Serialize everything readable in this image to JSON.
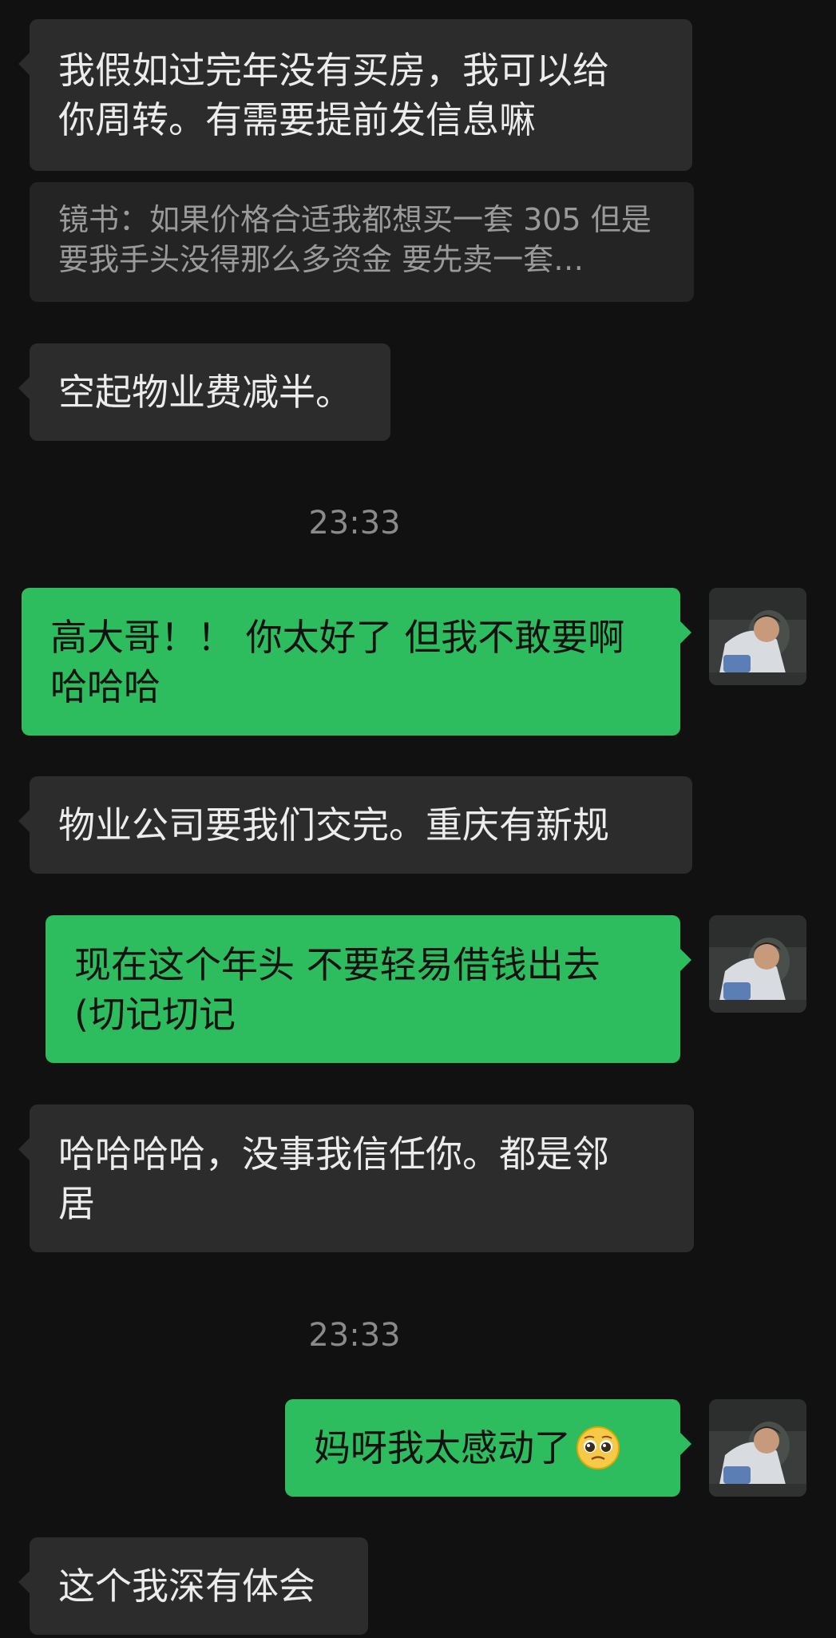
{
  "messages": [
    {
      "side": "left",
      "text": "我假如过完年没有买房，我可以给\n你周转。有需要提前发信息嘛"
    },
    {
      "side": "quote",
      "text": "镜书：如果价格合适我都想买一套 305 但是要我手头没得那么多资金 要先卖一套…"
    },
    {
      "side": "left",
      "text": "空起物业费减半。"
    },
    {
      "side": "timestamp",
      "text": "23:33"
    },
    {
      "side": "right",
      "text": "高大哥！！ 你太好了 但我不敢要啊\n哈哈哈"
    },
    {
      "side": "left",
      "text": "物业公司要我们交完。重庆有新规"
    },
    {
      "side": "right",
      "text": "现在这个年头 不要轻易借钱出去\n(切记切记"
    },
    {
      "side": "left",
      "text": "哈哈哈哈，没事我信任你。都是邻\n居"
    },
    {
      "side": "timestamp",
      "text": "23:33"
    },
    {
      "side": "right",
      "text": "妈呀我太感动了",
      "emoji": "pleading-face-emoji"
    },
    {
      "side": "left",
      "text": "这个我深有体会"
    }
  ],
  "colors": {
    "background": "#111111",
    "incoming_bubble": "#2c2c2c",
    "outgoing_bubble": "#2dbd5f",
    "quote_bubble": "#242424"
  }
}
